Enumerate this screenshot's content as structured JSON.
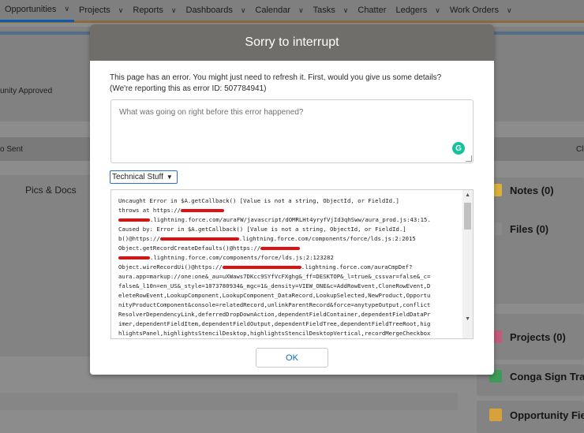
{
  "nav": {
    "items": [
      {
        "label": "Opportunities",
        "chevron": true
      },
      {
        "label": "Projects",
        "chevron": true
      },
      {
        "label": "Reports",
        "chevron": true
      },
      {
        "label": "Dashboards",
        "chevron": true
      },
      {
        "label": "Calendar",
        "chevron": true
      },
      {
        "label": "Tasks",
        "chevron": true
      },
      {
        "label": "Chatter",
        "chevron": false
      },
      {
        "label": "Ledgers",
        "chevron": true
      },
      {
        "label": "Work Orders",
        "chevron": true
      }
    ]
  },
  "background": {
    "approved_text": "unity Approved",
    "sent_text": "o Sent",
    "cl_text": "Cl",
    "pics_tab": "Pics & Docs",
    "right_cards": [
      {
        "label": "Notes (0)",
        "icon": "notes-icon",
        "color": "#d8b13a"
      },
      {
        "label": "Files (0)",
        "icon": "files-icon",
        "color": "#8a8a8a"
      },
      {
        "label": "Projects (0)",
        "icon": "projects-icon",
        "color": "#c25a7a"
      },
      {
        "label": "Conga Sign Tran",
        "icon": "conga-icon",
        "color": "#3f9a5a"
      },
      {
        "label": "Opportunity Fie",
        "icon": "crown-icon",
        "color": "#d8a13a"
      }
    ]
  },
  "modal": {
    "title": "Sorry to interrupt",
    "message_line1": "This page has an error. You might just need to refresh it. First, would you give us some details?",
    "message_line2": "(We're reporting this as error ID: 507784941)",
    "comment_placeholder": "What was going on right before this error happened?",
    "select_value": "Technical Stuff",
    "ok_label": "OK",
    "trace_lines": [
      "Uncaught Error in $A.getCallback() [Value is not a string, ObjectId, or FieldId.]",
      "throws at https://",
      ".lightning.force.com/auraFW/javascript/dOMRLHt4yryfVjId3qhSww/aura_prod.js:43:15.",
      "Caused by: Error in $A.getCallback() [Value is not a string, ObjectId, or FieldId.]",
      "b()@https://",
      ".lightning.force.com/components/force/lds.js:2:2015",
      "Object.getRecordCreateDefaults()@https://",
      ".lightning.force.com/components/force/lds.js:2:123282",
      "Object.wireRecordUi()@https://",
      ".lightning.force.com/auraCmpDef?",
      "aura.app=markup://one:one&_au=uXWaws7DKcc9SYfVcFXghg&_ff=DESKTOP&_l=true&_cssvar=false&_c=",
      "false&_l10n=en_US&_style=1073780934&_mgc=1&_density=VIEW_ONE&c=AddRowEvent,CloneRowEvent,D",
      "eleteRowEvent,LookupComponent,LookupComponent_DataRecord,LookupSelected,NewProduct,Opportu",
      "nityProductComponent&console=relatedRecord,unlinkParentRecord&force=anytypeOutput,conflict",
      "ResolverDependencyLink,deferredDropDownAction,dependentFieldContainer,dependentFieldDataPr",
      "imer,dependentFieldItem,dependentFieldOutput,dependentFieldTree,dependentFieldTreeRoot,hig",
      "hlightsPanel,highlightsStencilDesktop,highlightsStencilDesktopVertical,recordMergeCheckbox"
    ]
  }
}
